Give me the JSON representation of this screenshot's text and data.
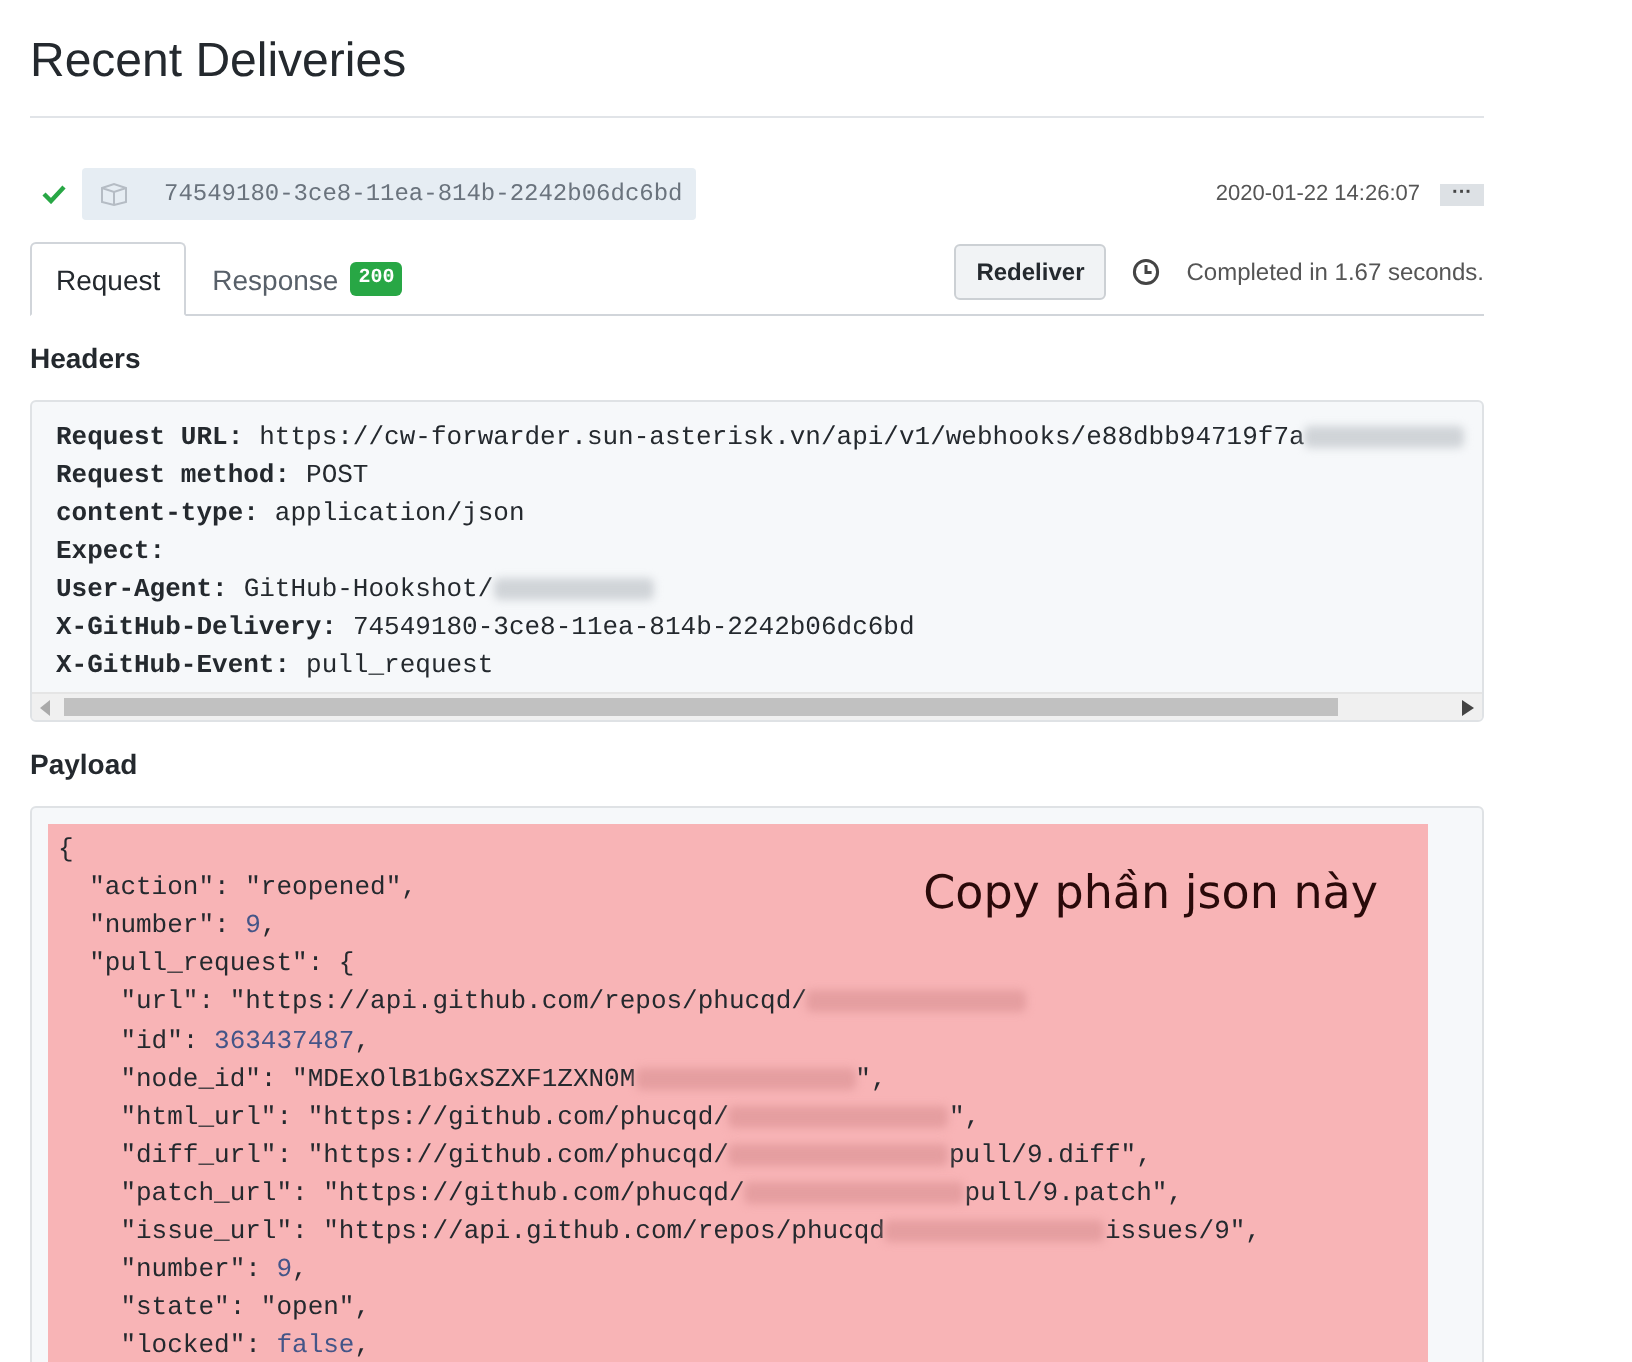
{
  "title": "Recent Deliveries",
  "delivery": {
    "success": true,
    "guid": "74549180-3ce8-11ea-814b-2242b06dc6bd",
    "time": "2020-01-22 14:26:07",
    "more": "···"
  },
  "tabs": [
    {
      "label": "Request",
      "selected": true
    },
    {
      "label": "Response",
      "selected": false,
      "badge": "200"
    }
  ],
  "redeliver": "Redeliver",
  "completed": "Completed in 1.67 seconds.",
  "headers": {
    "heading": "Headers",
    "lines": [
      {
        "name": "Request URL:",
        "value": "https://cw-forwarder.sun-asterisk.vn/api/v1/webhooks/e88dbb94719f7a",
        "blurred": true
      },
      {
        "name": "Request method:",
        "value": "POST",
        "blurred": false
      },
      {
        "name": "content-type:",
        "value": "application/json",
        "blurred": false
      },
      {
        "name": "Expect:",
        "blurred": false
      },
      {
        "name": "User-Agent:",
        "value": "GitHub-Hookshot/",
        "blurred": true
      },
      {
        "name": "X-GitHub-Delivery:",
        "value": "74549180-3ce8-11ea-814b-2242b06dc6bd",
        "blurred": false
      },
      {
        "name": "X-GitHub-Event:",
        "value": "pull_request",
        "blurred": false
      }
    ]
  },
  "payload": {
    "heading": "Payload",
    "note": "Copy phần json này",
    "lines": [
      [
        {
          "kind": "text",
          "text": "{"
        }
      ],
      [
        {
          "kind": "text",
          "text": "  \"action\": \"reopened\","
        }
      ],
      [
        {
          "kind": "text",
          "text": "  \"number\": "
        },
        {
          "kind": "number",
          "text": "9"
        },
        {
          "kind": "text",
          "text": ","
        }
      ],
      [
        {
          "kind": "text",
          "text": "  \"pull_request\": {"
        }
      ],
      [
        {
          "kind": "text",
          "text": "    \"url\": \"https://api.github.com/repos/phucqd/"
        },
        {
          "kind": "blur"
        }
      ],
      [
        {
          "kind": "text",
          "text": "    \"id\": "
        },
        {
          "kind": "number",
          "text": "363437487"
        },
        {
          "kind": "text",
          "text": ","
        }
      ],
      [
        {
          "kind": "text",
          "text": "    \"node_id\": \"MDExOlB1bGxSZXF1ZXN0M"
        },
        {
          "kind": "blur"
        },
        {
          "kind": "text",
          "text": "\","
        }
      ],
      [
        {
          "kind": "text",
          "text": "    \"html_url\": \"https://github.com/phucqd/"
        },
        {
          "kind": "blur"
        },
        {
          "kind": "text",
          "text": "\","
        }
      ],
      [
        {
          "kind": "text",
          "text": "    \"diff_url\": \"https://github.com/phucqd/"
        },
        {
          "kind": "blur"
        },
        {
          "kind": "text",
          "text": "pull/9.diff\","
        }
      ],
      [
        {
          "kind": "text",
          "text": "    \"patch_url\": \"https://github.com/phucqd/"
        },
        {
          "kind": "blur"
        },
        {
          "kind": "text",
          "text": "pull/9.patch\","
        }
      ],
      [
        {
          "kind": "text",
          "text": "    \"issue_url\": \"https://api.github.com/repos/phucqd"
        },
        {
          "kind": "blur"
        },
        {
          "kind": "text",
          "text": "issues/9\","
        }
      ],
      [
        {
          "kind": "text",
          "text": "    \"number\": "
        },
        {
          "kind": "number",
          "text": "9"
        },
        {
          "kind": "text",
          "text": ","
        }
      ],
      [
        {
          "kind": "text",
          "text": "    \"state\": \"open\","
        }
      ],
      [
        {
          "kind": "text",
          "text": "    \"locked\": "
        },
        {
          "kind": "number",
          "text": "false"
        },
        {
          "kind": "text",
          "text": ","
        }
      ]
    ]
  }
}
